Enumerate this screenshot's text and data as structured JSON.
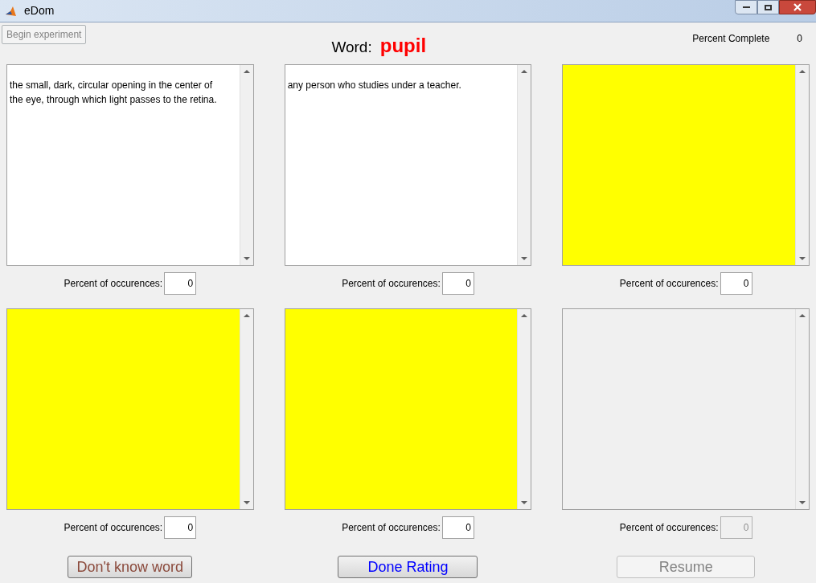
{
  "window": {
    "title": "eDom"
  },
  "begin_button": {
    "label": "Begin experiment",
    "disabled": true
  },
  "word": {
    "label": "Word:",
    "value": "pupil"
  },
  "progress": {
    "label": "Percent Complete",
    "value": "0"
  },
  "panels": [
    {
      "kind": "text",
      "text": "the small, dark, circular opening in the center of the eye, through which light passes to the retina.",
      "field_label": "Percent of occurences:",
      "field_value": "0",
      "disabled": false
    },
    {
      "kind": "text",
      "text": "any person who studies under a teacher.",
      "field_label": "Percent of occurences:",
      "field_value": "0",
      "disabled": false
    },
    {
      "kind": "highlight",
      "field_label": "Percent of occurences:",
      "field_value": "0",
      "disabled": false
    },
    {
      "kind": "highlight",
      "field_label": "Percent of occurences:",
      "field_value": "0",
      "disabled": false
    },
    {
      "kind": "highlight",
      "field_label": "Percent of occurences:",
      "field_value": "0",
      "disabled": false
    },
    {
      "kind": "blank",
      "field_label": "Percent of occurences:",
      "field_value": "0",
      "disabled": true
    }
  ],
  "buttons": [
    {
      "label": "Don't know word",
      "kind": "warn",
      "disabled": false
    },
    {
      "label": "Done Rating",
      "kind": "primary",
      "disabled": false
    },
    {
      "label": "Resume",
      "disabled": true
    }
  ]
}
